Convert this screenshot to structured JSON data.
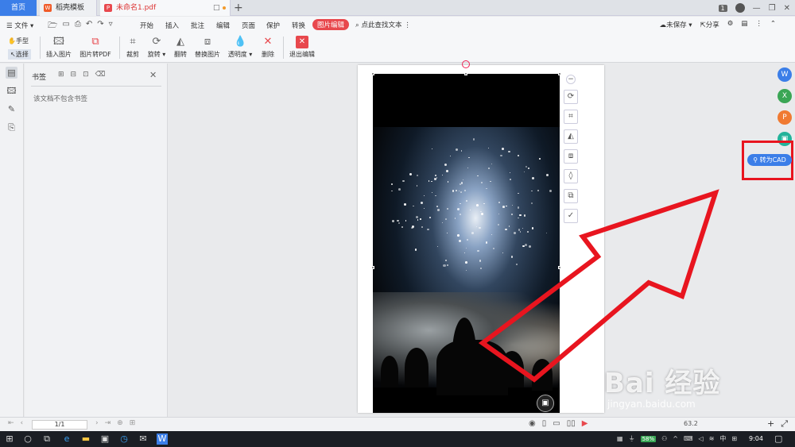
{
  "tabs": {
    "home": "首页",
    "template": "稻壳模板",
    "pdf": "未命名1.pdf",
    "close": "□",
    "add": "+"
  },
  "window": {
    "count_badge": "1",
    "min": "—",
    "restore": "❐",
    "close": "✕"
  },
  "menu": {
    "file": "☰ 文件 ▾",
    "items": [
      "开始",
      "插入",
      "批注",
      "编辑",
      "页面",
      "保护",
      "转换"
    ],
    "active": "图片编辑",
    "search": "点此查找文本",
    "more": "⋮",
    "right": [
      "未保存 ▾",
      "分享"
    ]
  },
  "ribbon": {
    "hand": "手型",
    "select": "选择",
    "buttons": [
      "插入图片",
      "图片转PDF",
      "裁剪",
      "旋转 ▾",
      "翻转",
      "替换图片",
      "透明度 ▾",
      "删除",
      "退出编辑"
    ]
  },
  "bookmark": {
    "title": "书签",
    "empty": "该文档不包含书签",
    "close": "✕"
  },
  "image": {
    "icon": "▣"
  },
  "side_tools": {
    "convert_cad": "转为CAD"
  },
  "status": {
    "page": "1/1",
    "zoom": "63.2"
  },
  "taskbar": {
    "battery": "58%",
    "ime": "中",
    "time": "9:04"
  },
  "watermark": {
    "brand": "Bai 经验",
    "url": "jingyan.baidu.com"
  },
  "colors": {
    "accent": "#3b7ee8",
    "highlight": "#e8151f",
    "active_tab": "#e8484d"
  }
}
